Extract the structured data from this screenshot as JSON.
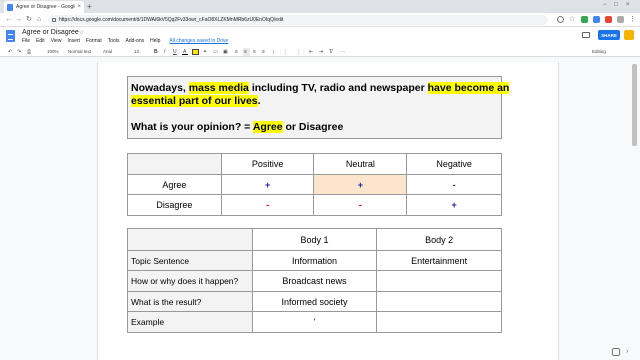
{
  "browser": {
    "tab_title": "Agree or Disagree - Google Do",
    "tab_close": "×",
    "new_tab": "+",
    "url": "https://docs.google.com/document/d/1DWAI6kV5Qq2Fv33owr_cFaO8XLZKMnMRb6zU0EnOIqQ/edit",
    "win_min": "−",
    "win_max": "□",
    "win_close": "×",
    "back": "←",
    "forward": "→",
    "reload": "↻",
    "home": "⌂"
  },
  "docs": {
    "title": "Agree or Disagree",
    "star": "☆",
    "menu": [
      "File",
      "Edit",
      "View",
      "Insert",
      "Format",
      "Tools",
      "Add-ons",
      "Help"
    ],
    "saved_status": "All changes saved in Drive",
    "share_label": "SHARE",
    "editing_label": "Editing"
  },
  "toolbar": {
    "undo": "↶",
    "redo": "↷",
    "print": "⎙",
    "zoom": "100%",
    "style": "Normal text",
    "font": "Arial",
    "size": "13",
    "bold": "B",
    "italic": "I",
    "underline": "U",
    "text_color": "A",
    "link": "⚭",
    "comment": "▭",
    "image": "▣",
    "align_left": "≡",
    "align_center": "≡",
    "align_right": "≡",
    "justify": "≡",
    "line_spacing": "↕",
    "numbered_list": "⋮",
    "bullet_list": "⋮",
    "indent_less": "⇤",
    "indent_more": "⇥",
    "clear_format": "T̸",
    "more": "⋯"
  },
  "document": {
    "para1_a": "Nowadays, ",
    "para1_b": "mass media",
    "para1_c": " including TV, radio and newspaper ",
    "para1_d": "have become an",
    "para1_e": "essential part of our lives",
    "para1_f": ".",
    "para2_a": "What is your opinion? = ",
    "para2_b": "Agree",
    "para2_c": " or Disagree",
    "table1": {
      "headers": [
        "Positive",
        "Neutral",
        "Negative"
      ],
      "rows": [
        {
          "label": "Agree",
          "cells": [
            "+",
            "+",
            "-"
          ]
        },
        {
          "label": "Disagree",
          "cells": [
            "-",
            "-",
            "+"
          ]
        }
      ]
    },
    "table2": {
      "headers": [
        "Body 1",
        "Body 2"
      ],
      "rows": [
        {
          "label": "Topic Sentence",
          "cells": [
            "Information",
            "Entertainment"
          ]
        },
        {
          "label": "How or why does it happen?",
          "cells": [
            "Broadcast news",
            ""
          ]
        },
        {
          "label": "What is the result?",
          "cells": [
            "Informed society",
            ""
          ]
        },
        {
          "label": "Example",
          "cells": [
            "'",
            ""
          ]
        }
      ]
    }
  },
  "colors": {
    "highlight": "#ffff00",
    "plus": "#1c1ca8",
    "minus": "#cc0000",
    "neutral_agree_cell": "#fce5cd",
    "share": "#1a73e8"
  }
}
